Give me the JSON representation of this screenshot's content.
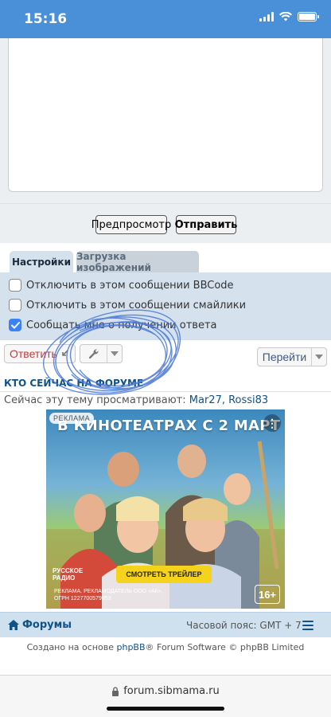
{
  "status_bar": {
    "time": "15:16"
  },
  "post_form": {
    "preview_label": "Предпросмотр",
    "submit_label": "Отправить"
  },
  "tabs": [
    {
      "label": "Настройки",
      "active": true
    },
    {
      "label": "Загрузка изображений",
      "active": false
    }
  ],
  "options": [
    {
      "label": "Отключить в этом сообщении BBCode",
      "checked": false
    },
    {
      "label": "Отключить в этом сообщении смайлики",
      "checked": false
    },
    {
      "label": "Сообщать мне о получении ответа",
      "checked": true
    }
  ],
  "actions": {
    "reply_label": "Ответить",
    "jump_label": "Перейти"
  },
  "who_online": {
    "heading": "КТО СЕЙЧАС НА ФОРУМЕ",
    "viewing_prefix": "Сейчас эту тему просматривают:",
    "users": "Mar27, Rossi83"
  },
  "ad": {
    "tag": "РЕКЛАМА",
    "headline": "В КИНОТЕАТРАХ С 2 МАРТ",
    "cta": "СМОТРЕТЬ ТРЕЙЛЕР",
    "logo": "РУССКОЕ РАДИО",
    "legal_line1": "РЕКЛАМА. РЕКЛАМОДАТЕЛЬ ООО «АК»,",
    "legal_line2": "ОГРН 1227700579853",
    "age_rating": "16+"
  },
  "footer": {
    "home_label": "Форумы",
    "timezone": "Часовой пояс: GMT + 7",
    "created_prefix": "Создано на основе",
    "phpbb_link": "phpBB",
    "created_suffix": "® Forum Software © phpBB Limited"
  },
  "browser": {
    "url": "forum.sibmama.ru"
  },
  "colors": {
    "status_bar": "#4a90d9",
    "link": "#105289",
    "reply_text": "#c43a3a",
    "checkbox_checked": "#3b82f6",
    "panel": "#d5e2ee",
    "scribble": "#4a78d8"
  }
}
